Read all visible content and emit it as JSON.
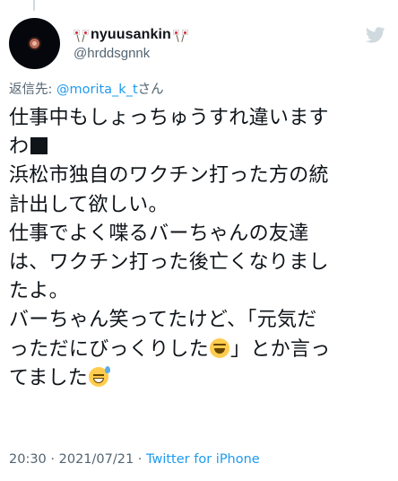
{
  "author": {
    "display_name": "nyuusankin",
    "handle": "@hrddsgnnk",
    "avatar_icon": "avatar",
    "name_icons": [
      "flag-icon",
      "flag-icon"
    ]
  },
  "platform_icon": "twitter-bird-icon",
  "reply": {
    "prefix": "返信先: ",
    "mention": "@morita_k_t",
    "suffix": "さん"
  },
  "tweet": {
    "lines": [
      "仕事中もしょっちゅうすれ違います",
      "わ",
      "浜松市独自のワクチン打った方の統",
      "計出して欲しい。",
      "仕事でよく喋るバーちゃんの友達",
      "は、ワクチン打った後亡くなりまし",
      "たよ。",
      "バーちゃん笑ってたけど、「元気だ",
      "っただにびっくりした",
      "」とか言っ",
      "てました"
    ],
    "inline_icons": {
      "line2": "black-square-icon",
      "line9": "laughing-face-icon",
      "line11": "sweat-smile-face-icon"
    }
  },
  "meta": {
    "time": "20:30",
    "separator": " · ",
    "date": "2021/07/21",
    "source": "Twitter for iPhone"
  },
  "colors": {
    "text": "#0f1419",
    "secondary": "#536471",
    "link": "#1d9bf0",
    "twitter_icon": "#cfd9de"
  }
}
